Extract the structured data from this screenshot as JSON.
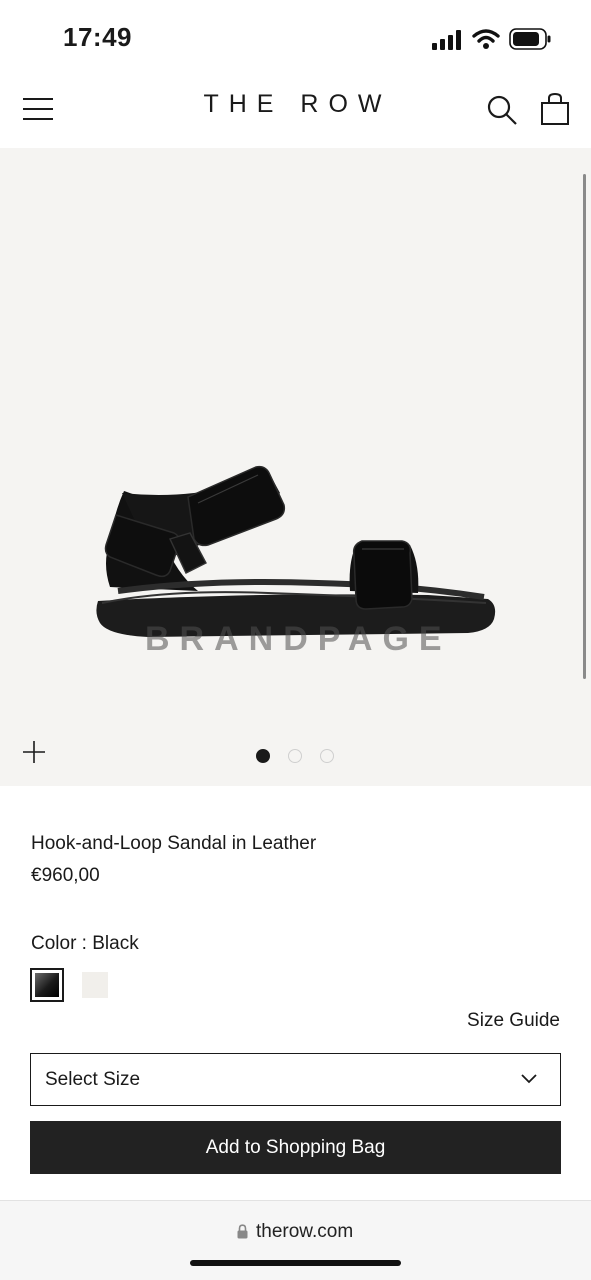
{
  "status_bar": {
    "time": "17:49"
  },
  "header": {
    "brand": "THE ROW"
  },
  "gallery": {
    "watermark": "BRANDPAGE",
    "image_count": 3,
    "active_index": 0
  },
  "product": {
    "name": "Hook-and-Loop Sandal in Leather",
    "price": "€960,00",
    "color_label": "Color : Black",
    "swatches": [
      {
        "name": "Black",
        "color": "#1a1a1a",
        "selected": true
      },
      {
        "name": "White",
        "color": "#f1efeb",
        "selected": false
      }
    ],
    "size_guide_label": "Size Guide",
    "size_select_label": "Select Size",
    "add_to_bag_label": "Add to Shopping Bag"
  },
  "browser": {
    "url": "therow.com"
  },
  "colors": {
    "accent": "#222222",
    "gallery_bg": "#f5f4f2"
  }
}
